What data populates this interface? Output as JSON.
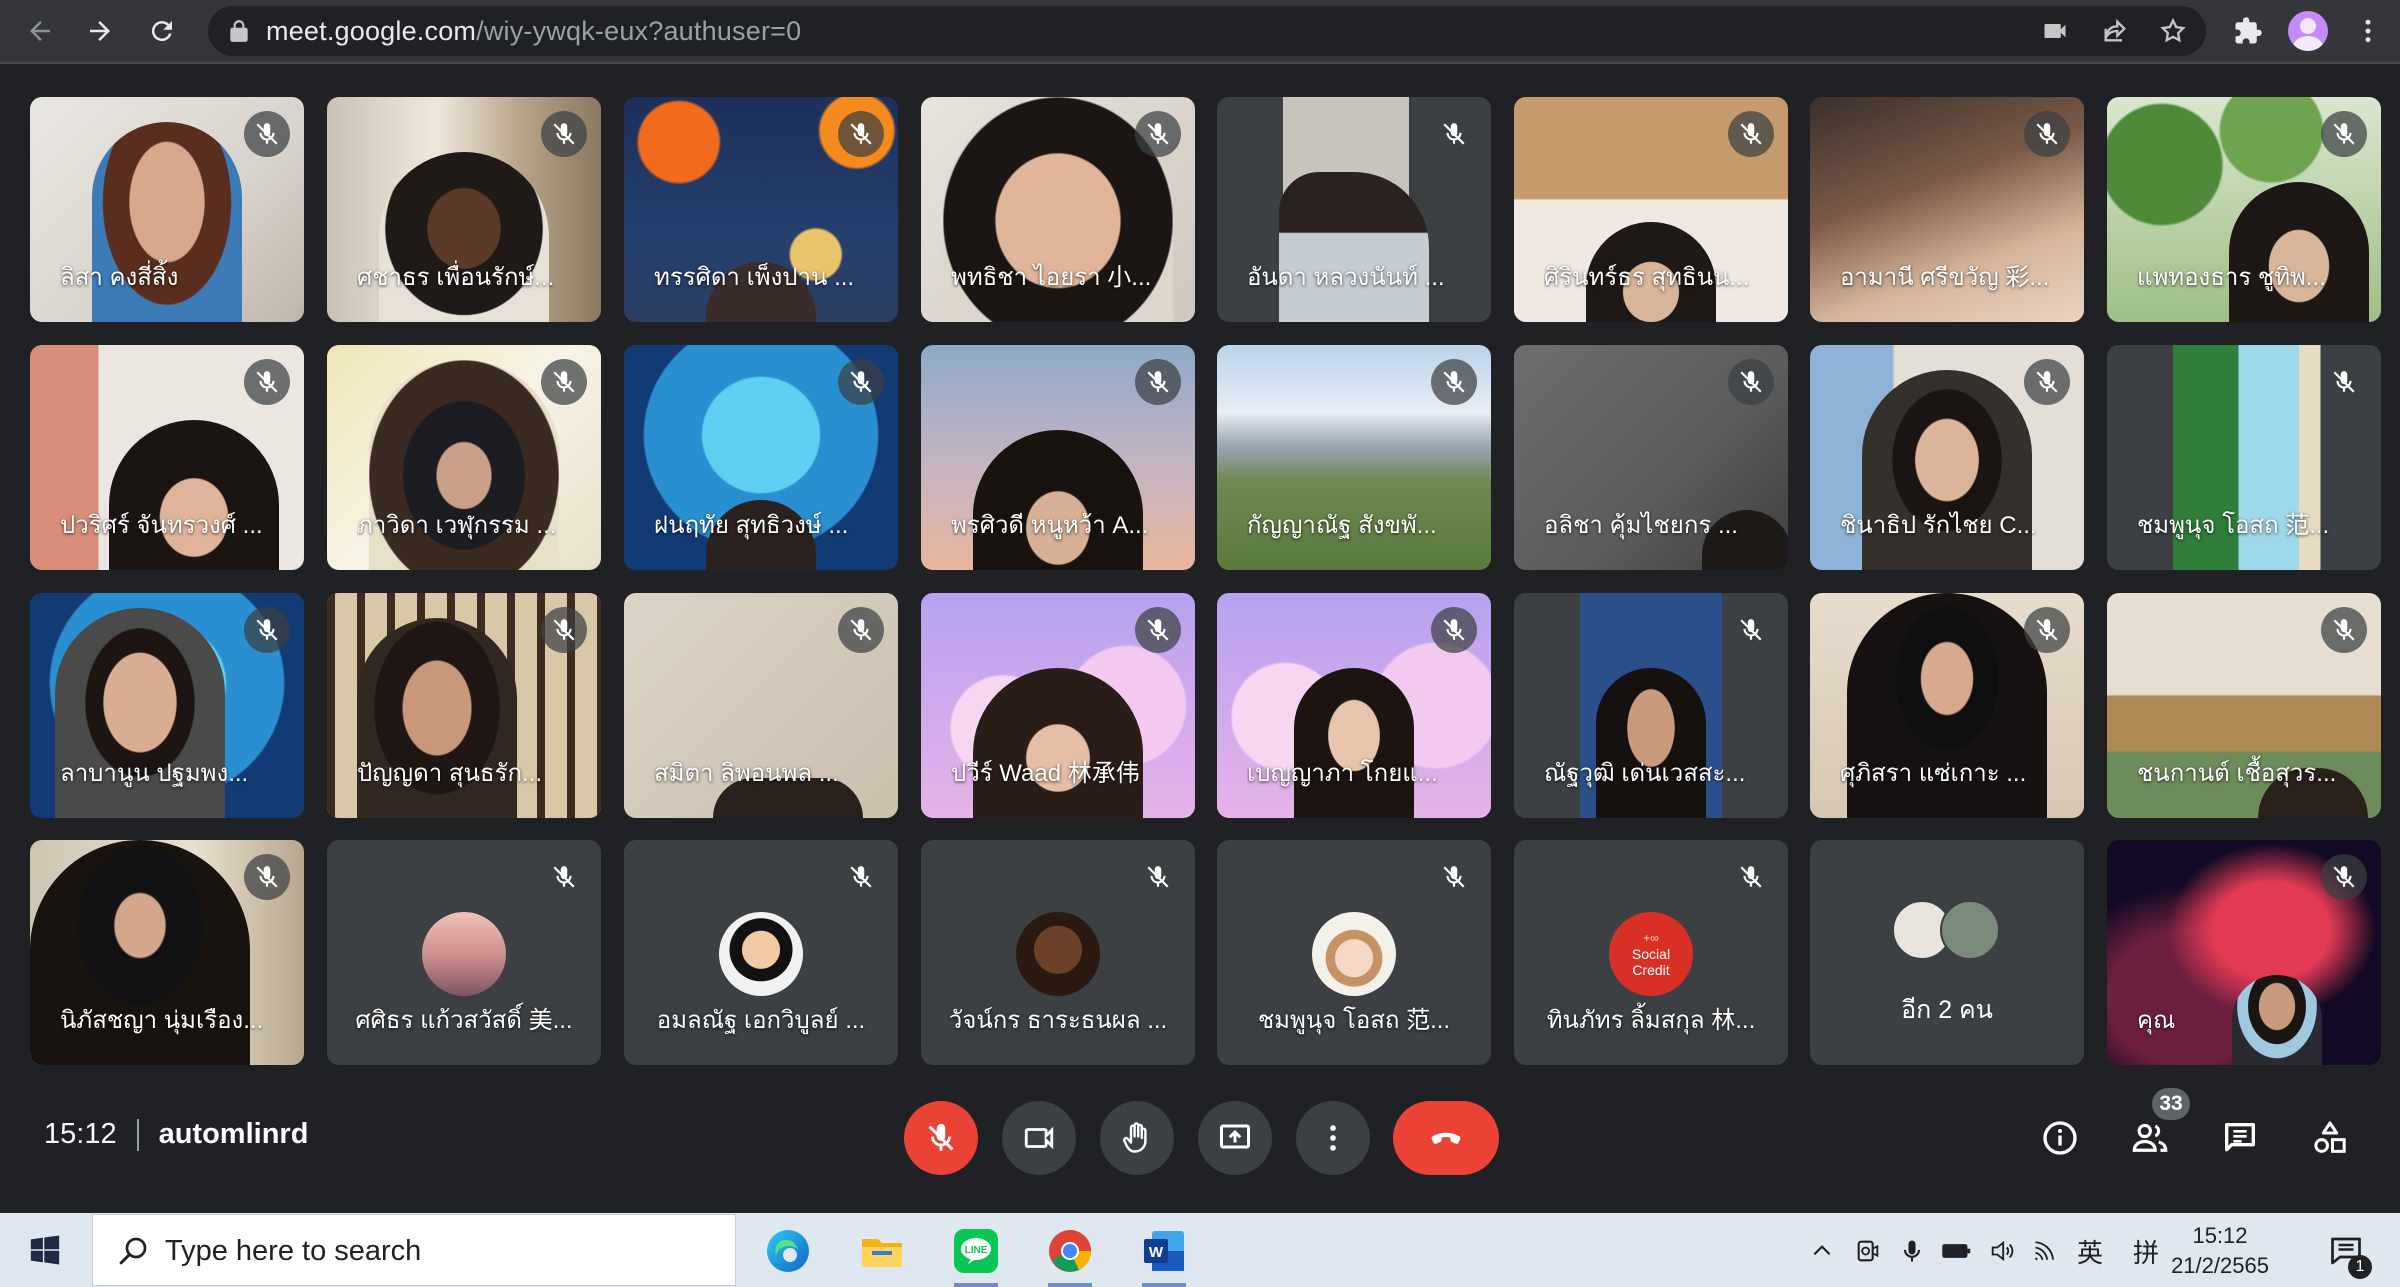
{
  "browser": {
    "url_host": "meet.google.com",
    "url_path": "/wiy-ywqk-eux?authuser=0"
  },
  "tiles": [
    {
      "name": "ลิสา คงสี่สิ้ง"
    },
    {
      "name": "ศชาธร เพื่อนรักษ์..."
    },
    {
      "name": "ทรรศิดา เพ็งปาน ..."
    },
    {
      "name": "พทธิชา ไอยรา 小..."
    },
    {
      "name": "อันดา หลวงนันท์ ..."
    },
    {
      "name": "ศิรินทร์ธร สุทธินน..."
    },
    {
      "name": "อามานี ศรีขวัญ 彩..."
    },
    {
      "name": "แพทองธาร ชูทิพ..."
    },
    {
      "name": "ปวริศร์ จันทรวงศ์ ..."
    },
    {
      "name": "ภาวิดา เวฬุกรรม ..."
    },
    {
      "name": "ฝนฤทัย สุทธิวงษ์ ..."
    },
    {
      "name": "พรศิวดี หนูหว้า A..."
    },
    {
      "name": "กัญญาณัฐ สังขพั..."
    },
    {
      "name": "อลิชา คุ้มไชยกร ..."
    },
    {
      "name": "ชินาธิป รักไชย C..."
    },
    {
      "name": "ชมพูนุจ โอสถ 范..."
    },
    {
      "name": "ลาบานูน ปฐมพง..."
    },
    {
      "name": "ปัญญดา สุนธรัก..."
    },
    {
      "name": "สมิตา ลิพอนพล ..."
    },
    {
      "name": "ปวีร์ Waad 林承伟"
    },
    {
      "name": "เบญญาภา โกยแ..."
    },
    {
      "name": "ณัฐวุฒิ เด่นเวสสะ..."
    },
    {
      "name": "ศุภิสรา แซ่เกาะ ..."
    },
    {
      "name": "ชนกานต์ เชื้อสุวร..."
    },
    {
      "name": "นิภัสชญา นุ่มเรือง..."
    },
    {
      "name": "ศศิธร แก้วสวัสดิ์ 美..."
    },
    {
      "name": "อมลณัฐ เอกวิบูลย์ ..."
    },
    {
      "name": "วัจน์กร ธาระธนผล ..."
    },
    {
      "name": "ชมพูนุจ โอสถ 范..."
    },
    {
      "name": "ทินภัทร ลิ้มสกุล 林..."
    },
    {
      "name": "อีก 2 คน"
    },
    {
      "name": "คุณ"
    }
  ],
  "social_credit": {
    "line1": "+∞",
    "line2": "Social",
    "line3": "Credit"
  },
  "meeting": {
    "time": "15:12",
    "code": "automlinrd",
    "participant_count": "33"
  },
  "taskbar": {
    "search_placeholder": "Type here to search",
    "ime_lang": "英",
    "ime_mode": "拼",
    "clock_time": "15:12",
    "clock_date": "21/2/2565",
    "notification_count": "1"
  },
  "colors": {
    "meet_bg": "#202124",
    "tile_bg": "#3c4043",
    "danger": "#ea4335",
    "taskbar": "#dfe7f1"
  }
}
